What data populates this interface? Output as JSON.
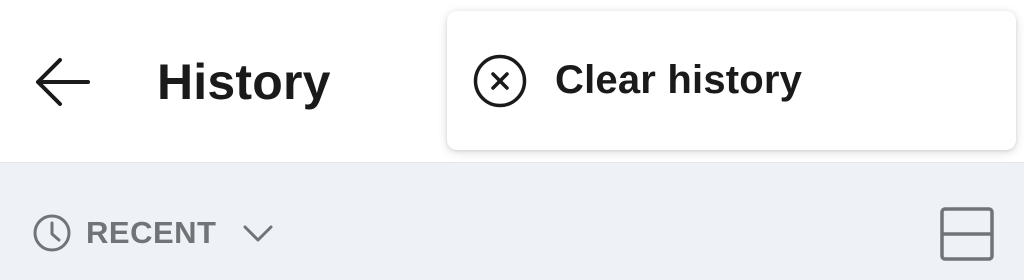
{
  "header": {
    "title": "History",
    "back_icon": "arrow-left-icon"
  },
  "filter": {
    "label": "RECENT",
    "icon": "clock-icon",
    "dropdown_icon": "chevron-down-icon"
  },
  "view_toggle": {
    "icon": "split-layout-icon"
  },
  "menu": {
    "items": [
      {
        "label": "Clear history",
        "icon": "close-circle-icon"
      }
    ]
  },
  "colors": {
    "text_primary": "#1a1a1a",
    "text_secondary": "#707478",
    "subbar_background": "#eef1f5"
  }
}
